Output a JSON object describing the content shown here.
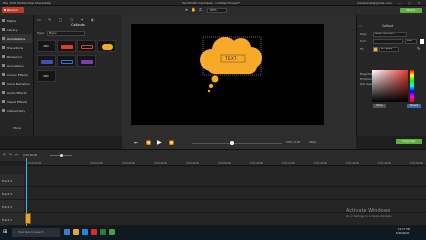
{
  "window": {
    "menu": [
      "File",
      "Edit",
      "Modify",
      "View",
      "Share",
      "Help"
    ],
    "title": "TechSmith Camtasia - Untitled Project*",
    "account": "manikanta@gmail.com",
    "controls": [
      "—",
      "□",
      "✕"
    ]
  },
  "toolbar": {
    "record_label": "Record",
    "tools": [
      "pointer-tool",
      "hand-tool",
      "crop-tool"
    ],
    "zoom": "80%",
    "share_label": "Share"
  },
  "sidebar": {
    "items": [
      {
        "label": "Media",
        "icon": "media-icon"
      },
      {
        "label": "Library",
        "icon": "library-icon"
      },
      {
        "label": "Annotations",
        "icon": "annotations-icon"
      },
      {
        "label": "Transitions",
        "icon": "transitions-icon"
      },
      {
        "label": "Behaviors",
        "icon": "behaviors-icon"
      },
      {
        "label": "Animations",
        "icon": "animations-icon"
      },
      {
        "label": "Cursor Effects",
        "icon": "cursor-effects-icon"
      },
      {
        "label": "Voice Narration",
        "icon": "voice-narration-icon"
      },
      {
        "label": "Audio Effects",
        "icon": "audio-effects-icon"
      },
      {
        "label": "Visual Effects",
        "icon": "visual-effects-icon"
      },
      {
        "label": "Interactivity",
        "icon": "interactivity-icon"
      }
    ],
    "more_label": "More"
  },
  "annotations_panel": {
    "title": "Callouts",
    "type_label": "Type:",
    "type_value": "Basic",
    "thumbnails": [
      {
        "kind": "text",
        "text": "ABC"
      },
      {
        "kind": "red-box"
      },
      {
        "kind": "red-outline"
      },
      {
        "kind": "yellow-cloud"
      },
      {
        "kind": "blue-box"
      },
      {
        "kind": "blue-outline"
      },
      {
        "kind": "purple-box"
      },
      {
        "kind": "text",
        "text": "ABC"
      }
    ]
  },
  "canvas": {
    "callout_text": "TEXT",
    "cloud_color": "#f7a928"
  },
  "player": {
    "time": "0:00 / 0:05",
    "fps": "30fps"
  },
  "properties": {
    "tab_label": "Callout",
    "style_label": "Style",
    "style_value": "Most Common",
    "font_label": "Font",
    "size_value": "100",
    "fill_label": "Fill",
    "color_hex": "#f7a928",
    "magnitude_label": "Magnitude",
    "fill_opacity_label": "Fill Opacity",
    "text_opacity_label": "Text Opacity",
    "more_label": "More",
    "preset_label": "Preset"
  },
  "timeline": {
    "time_label": "0:00:00;00",
    "ruler": [
      "0:00:00;00",
      "0:00:10;00",
      "0:00:20;00",
      "0:00:30;00",
      "0:00:40;00",
      "0:00:50;00",
      "0:01:00;00",
      "0:01:10;00",
      "0:01:20;00",
      "0:01:30;00",
      "0:01:40;00",
      "0:01:50;00",
      "0:02:00;00"
    ],
    "tracks": [
      "Track 4",
      "Track 3",
      "Track 2",
      "Track 1"
    ],
    "properties_button": "Properties"
  },
  "watermark": {
    "line1": "Activate Windows",
    "line2": "Go to Settings to activate Windows."
  },
  "taskbar": {
    "search_placeholder": "Type here to search",
    "time": "10:57 PM",
    "date": "5/26/2020"
  }
}
